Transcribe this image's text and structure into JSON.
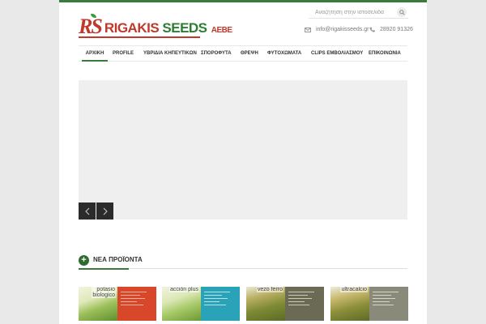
{
  "header": {
    "logo": {
      "mark": "RS",
      "text_part1": "RIGAKIS",
      "text_part2": "SEEDS",
      "text_part3": "ΑΕΒΕ"
    },
    "search": {
      "placeholder": "Αναζήτηση στην ιστοσελίδα",
      "icon": "search-icon"
    },
    "email": {
      "icon": "envelope-icon",
      "text": "info@rigakisseeds.gr"
    },
    "phone": {
      "icon": "phone-icon",
      "text": "28920 91326"
    }
  },
  "nav": {
    "items": [
      {
        "label": "ΑΡΧΙΚΗ",
        "active": true
      },
      {
        "label": "PROFILE"
      },
      {
        "label": "ΥΒΡΙΔΙΑ ΚΗΠΕΥΤΙΚΩΝ"
      },
      {
        "label": "ΣΠΟΡΟΦΥΤΑ"
      },
      {
        "label": "ΘΡΕΨΗ"
      },
      {
        "label": "ΦΥΤΟΧΩΜΑΤΑ"
      },
      {
        "label": "CLIPS ΕΜΒΟΛΙΑΣΜΟΥ"
      },
      {
        "label": "ΕΠΙΚΟΙΝΩΝΙΑ"
      }
    ]
  },
  "slider": {
    "prev_icon": "chevron-left-icon",
    "next_icon": "chevron-right-icon"
  },
  "new_products": {
    "icon": "plus-icon",
    "title": "ΝΕΑ ΠΡΟΪΟΝΤΑ",
    "items": [
      {
        "name_line1": "potasio",
        "name_line2": "biologico",
        "accent": "#d9472b"
      },
      {
        "name_line1": "acción plus",
        "name_line2": "",
        "accent": "#2aa3b8"
      },
      {
        "name_line1": "vezo ferro",
        "name_line2": "",
        "accent": "#6b6b55"
      },
      {
        "name_line1": "ultracalcio",
        "name_line2": "",
        "accent": "#8a8a7a"
      }
    ]
  },
  "colors": {
    "brand_green": "#3a7a3a",
    "brand_red": "#c0392b"
  }
}
